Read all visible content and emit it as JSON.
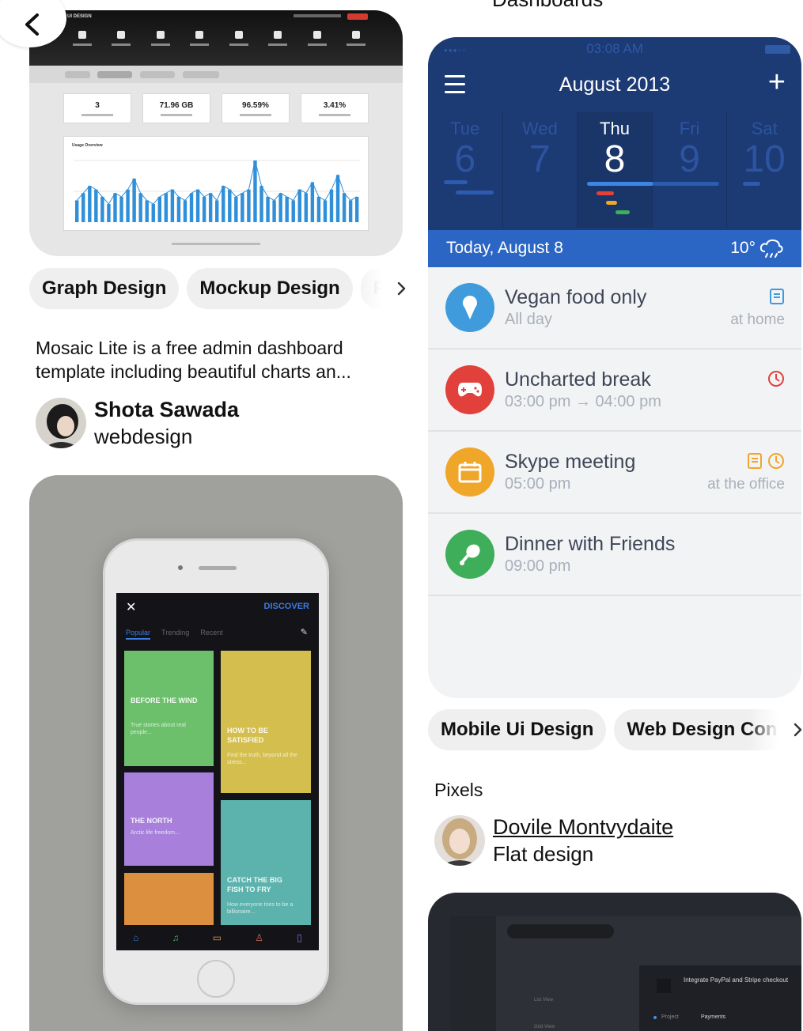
{
  "nav": {
    "back_label": "Back"
  },
  "right_column_header": "Dashboards",
  "pin_dashboard": {
    "brand": "UI DESIGN",
    "stats": [
      {
        "value": "3"
      },
      {
        "value": "71.96 GB"
      },
      {
        "value": "96.59%"
      },
      {
        "value": "3.41%"
      }
    ],
    "chart_title": "Usage Overview",
    "chart_data": {
      "type": "bar",
      "values": [
        6,
        8,
        10,
        9,
        7,
        5,
        8,
        7,
        9,
        12,
        8,
        6,
        5,
        7,
        8,
        9,
        7,
        6,
        8,
        9,
        7,
        8,
        6,
        10,
        9,
        7,
        8,
        9,
        17,
        10,
        7,
        6,
        8,
        7,
        6,
        9,
        8,
        11,
        7,
        6,
        9,
        13,
        8,
        6,
        7
      ]
    }
  },
  "pin_dashboard_tags": [
    "Graph Design",
    "Mockup Design",
    "F"
  ],
  "pin_dashboard_desc": "Mosaic Lite is a free admin dashboard template including beautiful charts an...",
  "pin_dashboard_creator": {
    "name": "Shota Sawada",
    "board": "webdesign"
  },
  "pin_calendar": {
    "status_time": "03:08 AM",
    "month_title": "August 2013",
    "days": [
      {
        "name": "Tue",
        "num": "6"
      },
      {
        "name": "Wed",
        "num": "7"
      },
      {
        "name": "Thu",
        "num": "8"
      },
      {
        "name": "Fri",
        "num": "9"
      },
      {
        "name": "Sat",
        "num": "10"
      }
    ],
    "today_label": "Today, August 8",
    "temperature": "10°",
    "events": [
      {
        "title": "Vegan food only",
        "sub": "All day",
        "right": "at home",
        "color": "#3f9bdc",
        "icon": "ice-cream-icon"
      },
      {
        "title": "Uncharted break",
        "sub": "03:00 pm → 04:00 pm",
        "right": "",
        "color": "#e2413b",
        "icon": "gamepad-icon"
      },
      {
        "title": "Skype meeting",
        "sub": "05:00 pm",
        "right": "at the office",
        "color": "#f0a629",
        "icon": "calendar-icon"
      },
      {
        "title": "Dinner with Friends",
        "sub": "09:00 pm",
        "right": "",
        "color": "#3fae5a",
        "icon": "drumstick-icon"
      }
    ]
  },
  "pin_calendar_tags": [
    "Mobile Ui Design",
    "Web Design Con"
  ],
  "pin_calendar_desc": "Pixels",
  "pin_calendar_creator": {
    "name": "Dovile Montvydaite",
    "board": "Flat design"
  },
  "pin_discover": {
    "header": "DISCOVER",
    "tabs": [
      "Popular",
      "Trending",
      "Recent"
    ],
    "tiles": [
      {
        "title": "BEFORE THE WIND",
        "desc": "True stories about real people..."
      },
      {
        "title": "HOW TO BE SATISFIED",
        "desc": "Find the truth, beyond all the stress..."
      },
      {
        "title": "THE NORTH",
        "desc": "Arctic life freedom..."
      },
      {
        "title": "CATCH THE BIG FISH TO FRY",
        "desc": "How everyone tries to be a billionaire..."
      }
    ]
  },
  "pin_dark": {
    "card_title": "Integrate PayPal and Stripe checkout",
    "row_label": "Project",
    "row_value": "Payments",
    "menu": [
      "List View",
      "Grid View"
    ]
  }
}
